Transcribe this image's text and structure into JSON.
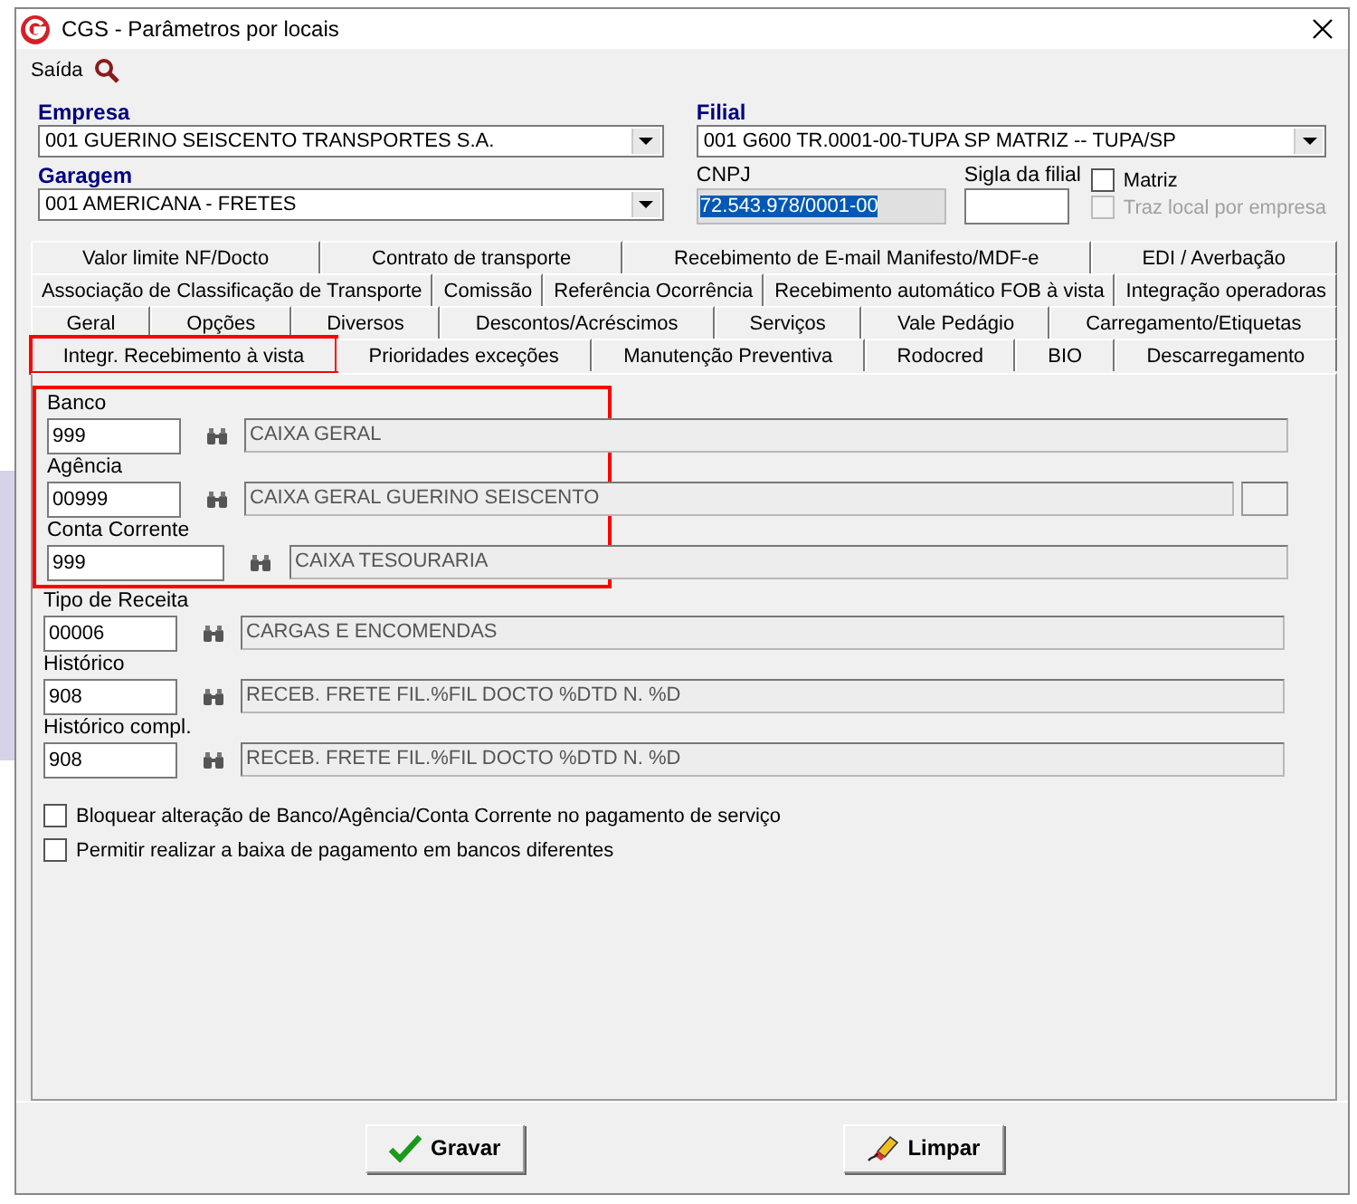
{
  "window": {
    "title": "CGS - Parâmetros por locais"
  },
  "menu": {
    "label": "Saída"
  },
  "header": {
    "empresa": {
      "label": "Empresa",
      "value": "001 GUERINO SEISCENTO TRANSPORTES S.A."
    },
    "filial": {
      "label": "Filial",
      "value": "001 G600 TR.0001-00-TUPA SP MATRIZ -- TUPA/SP"
    },
    "garagem": {
      "label": "Garagem",
      "value": "001 AMERICANA - FRETES"
    },
    "cnpj": {
      "label": "CNPJ",
      "value": "72.543.978/0001-00"
    },
    "sigla": {
      "label": "Sigla da filial"
    },
    "checks": [
      {
        "label": "Matriz",
        "checked": false,
        "disabled": false
      },
      {
        "label": "Traz local por empresa",
        "checked": false,
        "disabled": true
      }
    ]
  },
  "tab_rows": [
    [
      {
        "label": "Valor limite NF/Docto",
        "selected": false
      },
      {
        "label": "Contrato de transporte",
        "selected": false
      },
      {
        "label": "Recebimento de E-mail Manifesto/MDF-e",
        "selected": false
      },
      {
        "label": "EDI / Averbação",
        "selected": false
      }
    ],
    [
      {
        "label": "Associação de Classificação de Transporte",
        "selected": false
      },
      {
        "label": "Comissão",
        "selected": false
      },
      {
        "label": "Referência Ocorrência",
        "selected": false
      },
      {
        "label": "Recebimento automático FOB à vista",
        "selected": false
      },
      {
        "label": "Integração operadoras",
        "selected": false
      }
    ],
    [
      {
        "label": "Geral",
        "selected": false
      },
      {
        "label": "Opções",
        "selected": false
      },
      {
        "label": "Diversos",
        "selected": false
      },
      {
        "label": "Descontos/Acréscimos",
        "selected": false
      },
      {
        "label": "Serviços",
        "selected": false
      },
      {
        "label": "Vale Pedágio",
        "selected": false
      },
      {
        "label": "Carregamento/Etiquetas",
        "selected": false
      }
    ],
    [
      {
        "label": "Integr. Recebimento à vista",
        "selected": true,
        "highlighted": true
      },
      {
        "label": "Prioridades exceções",
        "selected": false,
        "highlighted": false
      },
      {
        "label": "Manutenção Preventiva",
        "selected": false,
        "highlighted": false
      },
      {
        "label": "Rodocred",
        "selected": false,
        "highlighted": false
      },
      {
        "label": "BIO",
        "selected": false,
        "highlighted": false
      },
      {
        "label": "Descarregamento",
        "selected": false,
        "highlighted": false
      }
    ]
  ],
  "fields": [
    {
      "kind": "lookup",
      "label": "Banco",
      "code": "999",
      "description": "CAIXA GERAL",
      "highlighted": true
    },
    {
      "kind": "lookup-extra",
      "label": "Agência",
      "code": "00999",
      "description": "CAIXA GERAL GUERINO SEISCENTO",
      "highlighted": true
    },
    {
      "kind": "lookup-wide",
      "label": "Conta Corrente",
      "code": "999",
      "description": "CAIXA TESOURARIA",
      "highlighted": true
    },
    {
      "kind": "lookup",
      "label": "Tipo de Receita",
      "code": "00006",
      "description": "CARGAS E ENCOMENDAS",
      "highlighted": false
    },
    {
      "kind": "lookup",
      "label": "Histórico",
      "code": "908",
      "description": "RECEB. FRETE FIL.%FIL DOCTO %DTD N. %D",
      "highlighted": false
    },
    {
      "kind": "lookup",
      "label": "Histórico compl.",
      "code": "908",
      "description": "RECEB. FRETE FIL.%FIL DOCTO %DTD N. %D",
      "highlighted": false
    }
  ],
  "options": [
    {
      "label": "Bloquear alteração de Banco/Agência/Conta Corrente no pagamento de serviço",
      "checked": false
    },
    {
      "label": "Permitir realizar a baixa de pagamento em bancos diferentes",
      "checked": false
    }
  ],
  "buttons": [
    {
      "kind": "save",
      "label": "Gravar"
    },
    {
      "kind": "clear",
      "label": "Limpar"
    }
  ]
}
